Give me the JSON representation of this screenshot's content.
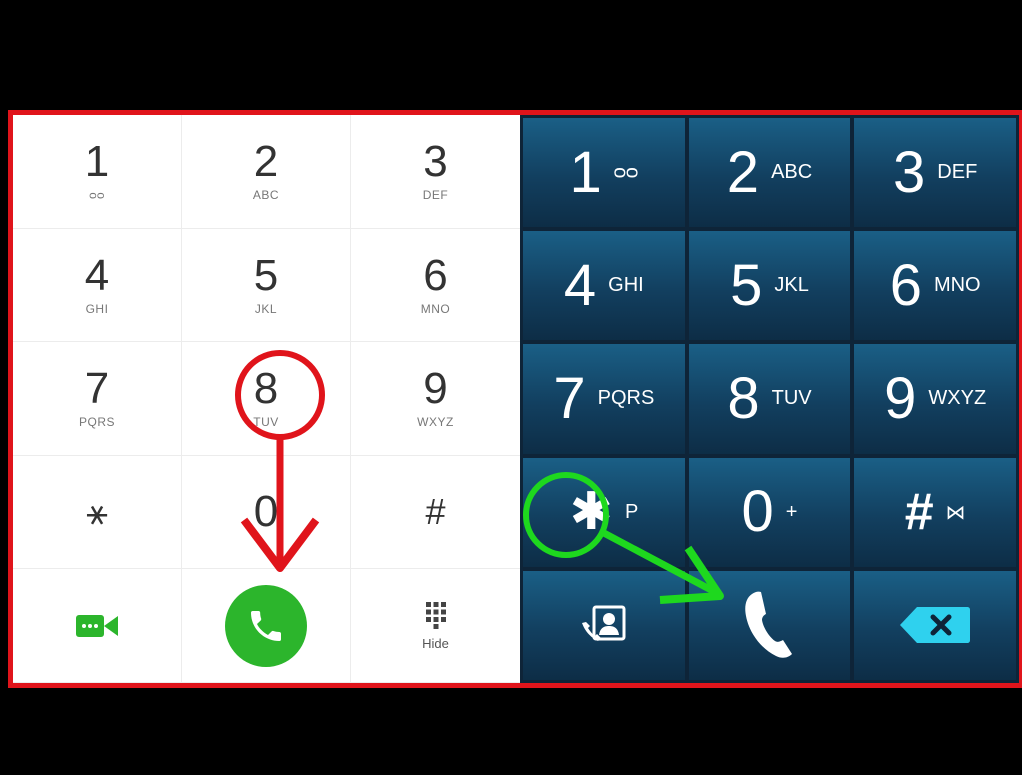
{
  "light_keypad": {
    "keys": [
      {
        "digit": "1",
        "letters": "ᴑᴑ"
      },
      {
        "digit": "2",
        "letters": "ABC"
      },
      {
        "digit": "3",
        "letters": "DEF"
      },
      {
        "digit": "4",
        "letters": "GHI"
      },
      {
        "digit": "5",
        "letters": "JKL"
      },
      {
        "digit": "6",
        "letters": "MNO"
      },
      {
        "digit": "7",
        "letters": "PQRS"
      },
      {
        "digit": "8",
        "letters": "TUV"
      },
      {
        "digit": "9",
        "letters": "WXYZ"
      },
      {
        "digit": "⚹",
        "letters": ""
      },
      {
        "digit": "0",
        "letters": ""
      },
      {
        "digit": "#",
        "letters": ""
      }
    ],
    "hide_label": "Hide",
    "call_color": "#2cb52c",
    "video_icon": "video-call-icon",
    "call_icon": "phone-icon",
    "keypad_icon": "keypad-grid-icon"
  },
  "dark_keypad": {
    "keys": [
      {
        "digit": "1",
        "letters": "ᴑᴑ"
      },
      {
        "digit": "2",
        "letters": "ABC"
      },
      {
        "digit": "3",
        "letters": "DEF"
      },
      {
        "digit": "4",
        "letters": "GHI"
      },
      {
        "digit": "5",
        "letters": "JKL"
      },
      {
        "digit": "6",
        "letters": "MNO"
      },
      {
        "digit": "7",
        "letters": "PQRS"
      },
      {
        "digit": "8",
        "letters": "TUV"
      },
      {
        "digit": "9",
        "letters": "WXYZ"
      },
      {
        "digit": "✱",
        "letters": "P"
      },
      {
        "digit": "0",
        "letters": "+"
      },
      {
        "digit": "#",
        "letters": "⋈"
      }
    ],
    "contacts_icon": "contacts-icon",
    "call_icon": "phone-icon",
    "backspace_icon": "backspace-icon"
  },
  "annotations": {
    "red_color": "#e0141b",
    "green_color": "#1ed81e"
  }
}
